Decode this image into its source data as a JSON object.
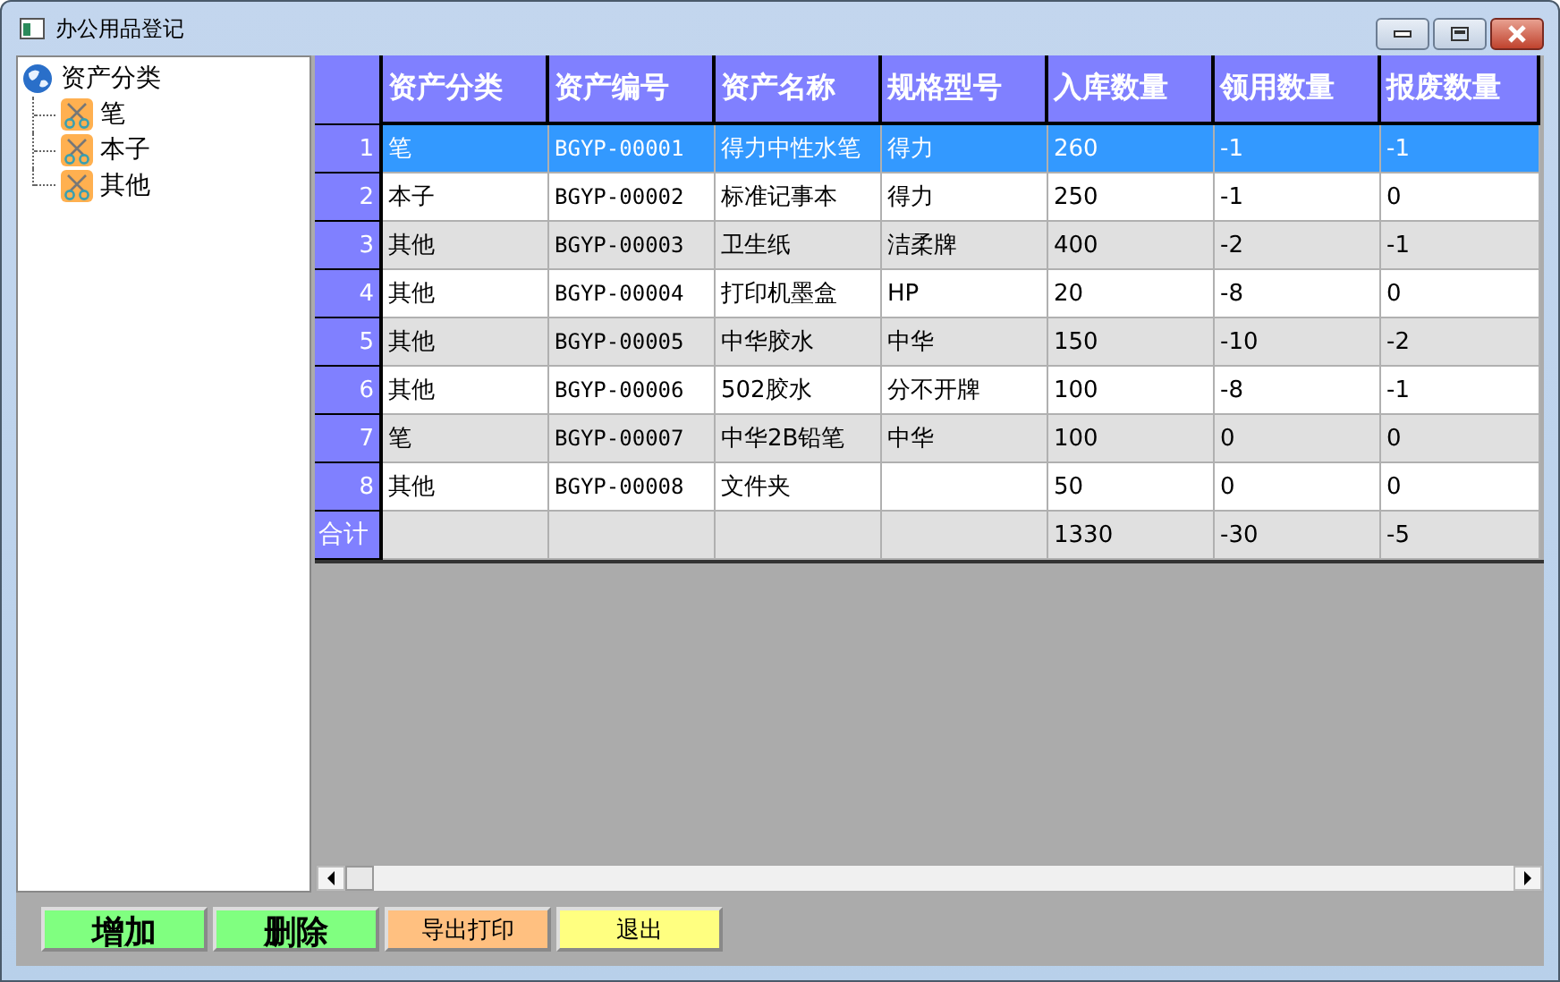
{
  "window": {
    "title": "办公用品登记"
  },
  "tree": {
    "label": "资产分类",
    "expanded": true,
    "children": [
      {
        "label": "笔"
      },
      {
        "label": "本子"
      },
      {
        "label": "其他"
      }
    ]
  },
  "table": {
    "columns": [
      "资产分类",
      "资产编号",
      "资产名称",
      "规格型号",
      "入库数量",
      "领用数量",
      "报废数量"
    ],
    "rows": [
      {
        "number": "1",
        "selected": true,
        "cells": [
          "笔",
          "BGYP-00001",
          "得力中性水笔",
          "得力",
          "260",
          "-1",
          "-1"
        ]
      },
      {
        "number": "2",
        "selected": false,
        "cells": [
          "本子",
          "BGYP-00002",
          "标准记事本",
          "得力",
          "250",
          "-1",
          "0"
        ]
      },
      {
        "number": "3",
        "selected": false,
        "cells": [
          "其他",
          "BGYP-00003",
          "卫生纸",
          "洁柔牌",
          "400",
          "-2",
          "-1"
        ]
      },
      {
        "number": "4",
        "selected": false,
        "cells": [
          "其他",
          "BGYP-00004",
          "打印机墨盒",
          "HP",
          "20",
          "-8",
          "0"
        ]
      },
      {
        "number": "5",
        "selected": false,
        "cells": [
          "其他",
          "BGYP-00005",
          "中华胶水",
          "中华",
          "150",
          "-10",
          "-2"
        ]
      },
      {
        "number": "6",
        "selected": false,
        "cells": [
          "其他",
          "BGYP-00006",
          "502胶水",
          "分不开牌",
          "100",
          "-8",
          "-1"
        ]
      },
      {
        "number": "7",
        "selected": false,
        "cells": [
          "笔",
          "BGYP-00007",
          "中华2B铅笔",
          "中华",
          "100",
          "0",
          "0"
        ]
      },
      {
        "number": "8",
        "selected": false,
        "cells": [
          "其他",
          "BGYP-00008",
          "文件夹",
          null,
          "50",
          "0",
          "0"
        ]
      }
    ],
    "total": {
      "label": "合计",
      "cells": [
        null,
        null,
        null,
        null,
        "1330",
        "-30",
        "-5"
      ]
    }
  },
  "buttons": [
    {
      "label": "增加",
      "kind": "large",
      "color": "#80ff80"
    },
    {
      "label": "删除",
      "kind": "large",
      "color": "#80ff80"
    },
    {
      "label": "导出打印",
      "kind": "small",
      "color": "#ffc080"
    },
    {
      "label": "退出",
      "kind": "small",
      "color": "#ffff80"
    }
  ]
}
